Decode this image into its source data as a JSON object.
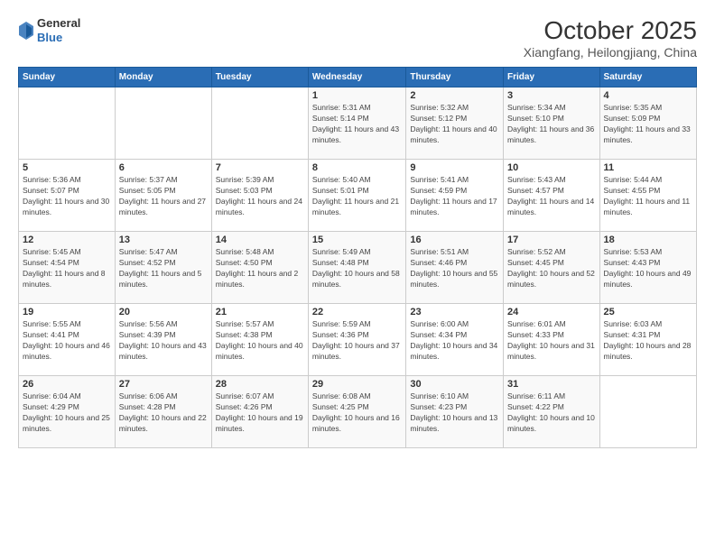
{
  "header": {
    "logo_general": "General",
    "logo_blue": "Blue",
    "month": "October 2025",
    "location": "Xiangfang, Heilongjiang, China"
  },
  "days_of_week": [
    "Sunday",
    "Monday",
    "Tuesday",
    "Wednesday",
    "Thursday",
    "Friday",
    "Saturday"
  ],
  "weeks": [
    [
      {
        "day": "",
        "info": ""
      },
      {
        "day": "",
        "info": ""
      },
      {
        "day": "",
        "info": ""
      },
      {
        "day": "1",
        "info": "Sunrise: 5:31 AM\nSunset: 5:14 PM\nDaylight: 11 hours and 43 minutes."
      },
      {
        "day": "2",
        "info": "Sunrise: 5:32 AM\nSunset: 5:12 PM\nDaylight: 11 hours and 40 minutes."
      },
      {
        "day": "3",
        "info": "Sunrise: 5:34 AM\nSunset: 5:10 PM\nDaylight: 11 hours and 36 minutes."
      },
      {
        "day": "4",
        "info": "Sunrise: 5:35 AM\nSunset: 5:09 PM\nDaylight: 11 hours and 33 minutes."
      }
    ],
    [
      {
        "day": "5",
        "info": "Sunrise: 5:36 AM\nSunset: 5:07 PM\nDaylight: 11 hours and 30 minutes."
      },
      {
        "day": "6",
        "info": "Sunrise: 5:37 AM\nSunset: 5:05 PM\nDaylight: 11 hours and 27 minutes."
      },
      {
        "day": "7",
        "info": "Sunrise: 5:39 AM\nSunset: 5:03 PM\nDaylight: 11 hours and 24 minutes."
      },
      {
        "day": "8",
        "info": "Sunrise: 5:40 AM\nSunset: 5:01 PM\nDaylight: 11 hours and 21 minutes."
      },
      {
        "day": "9",
        "info": "Sunrise: 5:41 AM\nSunset: 4:59 PM\nDaylight: 11 hours and 17 minutes."
      },
      {
        "day": "10",
        "info": "Sunrise: 5:43 AM\nSunset: 4:57 PM\nDaylight: 11 hours and 14 minutes."
      },
      {
        "day": "11",
        "info": "Sunrise: 5:44 AM\nSunset: 4:55 PM\nDaylight: 11 hours and 11 minutes."
      }
    ],
    [
      {
        "day": "12",
        "info": "Sunrise: 5:45 AM\nSunset: 4:54 PM\nDaylight: 11 hours and 8 minutes."
      },
      {
        "day": "13",
        "info": "Sunrise: 5:47 AM\nSunset: 4:52 PM\nDaylight: 11 hours and 5 minutes."
      },
      {
        "day": "14",
        "info": "Sunrise: 5:48 AM\nSunset: 4:50 PM\nDaylight: 11 hours and 2 minutes."
      },
      {
        "day": "15",
        "info": "Sunrise: 5:49 AM\nSunset: 4:48 PM\nDaylight: 10 hours and 58 minutes."
      },
      {
        "day": "16",
        "info": "Sunrise: 5:51 AM\nSunset: 4:46 PM\nDaylight: 10 hours and 55 minutes."
      },
      {
        "day": "17",
        "info": "Sunrise: 5:52 AM\nSunset: 4:45 PM\nDaylight: 10 hours and 52 minutes."
      },
      {
        "day": "18",
        "info": "Sunrise: 5:53 AM\nSunset: 4:43 PM\nDaylight: 10 hours and 49 minutes."
      }
    ],
    [
      {
        "day": "19",
        "info": "Sunrise: 5:55 AM\nSunset: 4:41 PM\nDaylight: 10 hours and 46 minutes."
      },
      {
        "day": "20",
        "info": "Sunrise: 5:56 AM\nSunset: 4:39 PM\nDaylight: 10 hours and 43 minutes."
      },
      {
        "day": "21",
        "info": "Sunrise: 5:57 AM\nSunset: 4:38 PM\nDaylight: 10 hours and 40 minutes."
      },
      {
        "day": "22",
        "info": "Sunrise: 5:59 AM\nSunset: 4:36 PM\nDaylight: 10 hours and 37 minutes."
      },
      {
        "day": "23",
        "info": "Sunrise: 6:00 AM\nSunset: 4:34 PM\nDaylight: 10 hours and 34 minutes."
      },
      {
        "day": "24",
        "info": "Sunrise: 6:01 AM\nSunset: 4:33 PM\nDaylight: 10 hours and 31 minutes."
      },
      {
        "day": "25",
        "info": "Sunrise: 6:03 AM\nSunset: 4:31 PM\nDaylight: 10 hours and 28 minutes."
      }
    ],
    [
      {
        "day": "26",
        "info": "Sunrise: 6:04 AM\nSunset: 4:29 PM\nDaylight: 10 hours and 25 minutes."
      },
      {
        "day": "27",
        "info": "Sunrise: 6:06 AM\nSunset: 4:28 PM\nDaylight: 10 hours and 22 minutes."
      },
      {
        "day": "28",
        "info": "Sunrise: 6:07 AM\nSunset: 4:26 PM\nDaylight: 10 hours and 19 minutes."
      },
      {
        "day": "29",
        "info": "Sunrise: 6:08 AM\nSunset: 4:25 PM\nDaylight: 10 hours and 16 minutes."
      },
      {
        "day": "30",
        "info": "Sunrise: 6:10 AM\nSunset: 4:23 PM\nDaylight: 10 hours and 13 minutes."
      },
      {
        "day": "31",
        "info": "Sunrise: 6:11 AM\nSunset: 4:22 PM\nDaylight: 10 hours and 10 minutes."
      },
      {
        "day": "",
        "info": ""
      }
    ]
  ]
}
